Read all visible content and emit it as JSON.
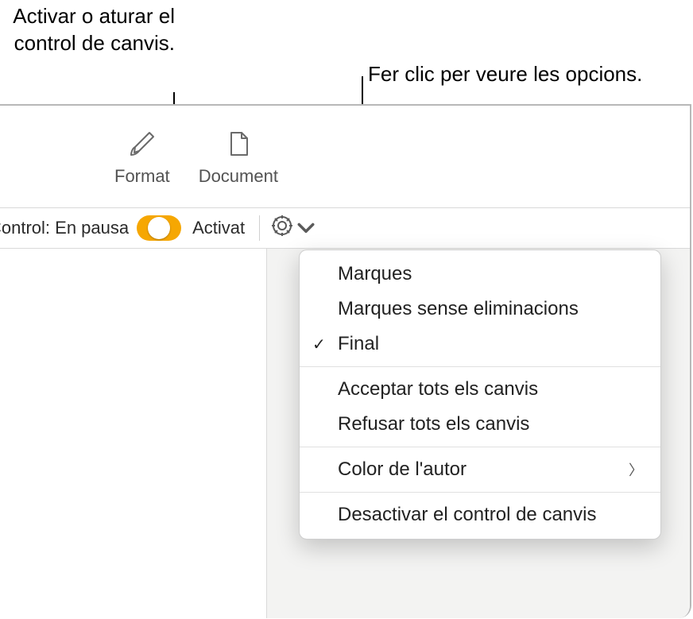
{
  "callouts": {
    "toggle": "Activar o aturar el control de canvis.",
    "options": "Fer clic per veure les opcions."
  },
  "toolbar": {
    "format": "Format",
    "document": "Document"
  },
  "tracking": {
    "status": "Control: En pausa",
    "on_label": "Activat"
  },
  "menu": {
    "markup": "Marques",
    "markup_no_del": "Marques sense eliminacions",
    "final": "Final",
    "accept_all": "Acceptar tots els canvis",
    "reject_all": "Refusar tots els canvis",
    "author_color": "Color de l'autor",
    "turn_off": "Desactivar el control de canvis"
  }
}
